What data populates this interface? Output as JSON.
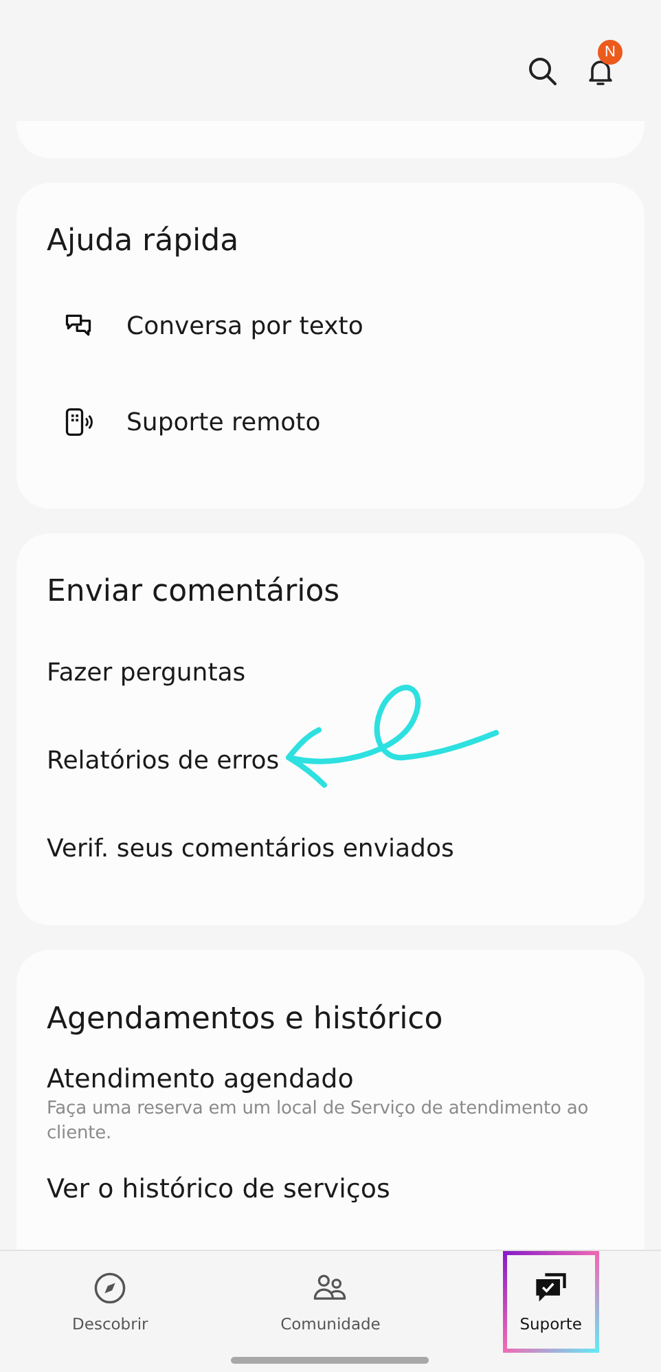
{
  "header": {
    "notification_badge": "N"
  },
  "quick_help": {
    "title": "Ajuda rápida",
    "items": [
      {
        "kind": "chat",
        "label": "Conversa por texto"
      },
      {
        "kind": "remote",
        "label": "Suporte remoto"
      }
    ]
  },
  "feedback": {
    "title": "Enviar comentários",
    "items": [
      {
        "label": "Fazer perguntas",
        "annotated": false
      },
      {
        "label": "Relatórios de erros",
        "annotated": true
      },
      {
        "label": "Verif. seus comentários enviados",
        "annotated": false
      }
    ]
  },
  "history": {
    "title": "Agendamentos e histórico",
    "items": [
      {
        "label": "Atendimento agendado",
        "description": "Faça uma reserva em um local de Serviço de atendimento ao cliente."
      },
      {
        "label": "Ver o histórico de serviços"
      }
    ]
  },
  "nav": [
    {
      "kind": "discover",
      "label": "Descobrir",
      "selected": false
    },
    {
      "kind": "community",
      "label": "Comunidade",
      "selected": false
    },
    {
      "kind": "support",
      "label": "Suporte",
      "selected": true
    }
  ]
}
